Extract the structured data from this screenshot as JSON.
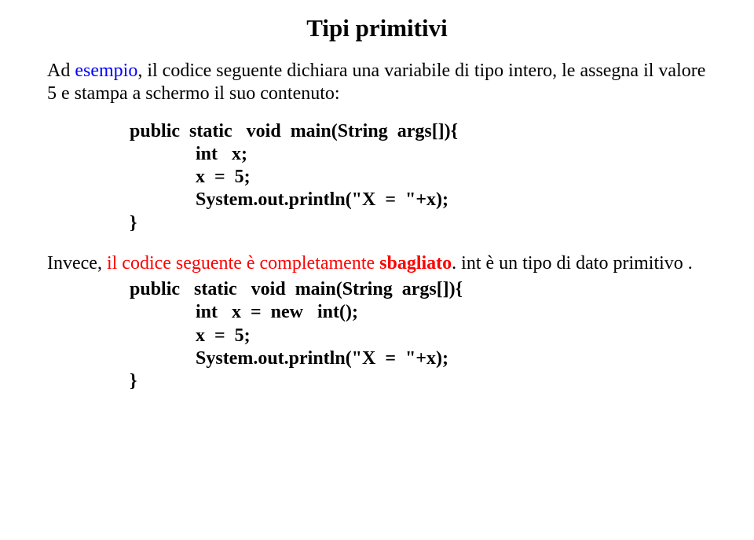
{
  "title": "Tipi primitivi",
  "intro": {
    "part1": "Ad ",
    "blue": "esempio",
    "part2": ", il codice seguente dichiara una variabile di tipo intero, le assegna il valore 5 e stampa a schermo il suo contenuto:"
  },
  "code1": {
    "l1": "public  static   void  main(String  args[]){",
    "l2": "              int   x;",
    "l3": "              x  =  5;",
    "l4": "              System.out.println(\"X  =  \"+x);",
    "l5": "}"
  },
  "intro2": {
    "part1": "Invece, ",
    "red1": "il codice seguente è completamente ",
    "red2": "sbagliato",
    "part2": ". int è un tipo di dato primitivo ."
  },
  "code2": {
    "l1": "public   static   void  main(String  args[]){",
    "l2": "              int   x  =  new   int();",
    "l3": "              x  =  5;",
    "l4": "              System.out.println(\"X  =  \"+x);",
    "l5": "}"
  }
}
